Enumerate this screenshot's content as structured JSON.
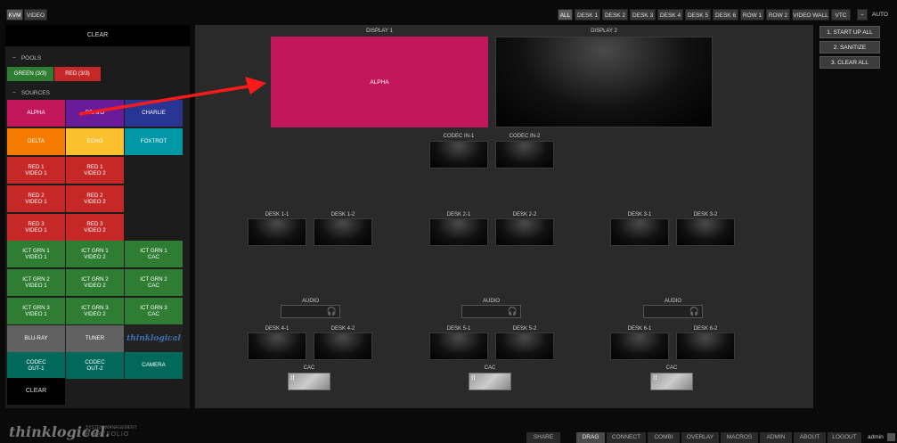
{
  "topbar": {
    "left": [
      "KVM",
      "VIDEO"
    ],
    "right": [
      "ALL",
      "DESK 1",
      "DESK 2",
      "DESK 3",
      "DESK 4",
      "DESK 5",
      "DESK 6",
      "ROW 1",
      "ROW 2",
      "VIDEO WALL",
      "VTC"
    ],
    "collapse": "−",
    "auto": "AUTO"
  },
  "left": {
    "clear_top": "CLEAR",
    "pools_header": "POOLS",
    "pools": [
      {
        "label": "GREEN (3/3)",
        "color": "#2e7d32"
      },
      {
        "label": "RED (3/3)",
        "color": "#c62828"
      }
    ],
    "sources_header": "SOURCES",
    "sources": [
      {
        "label": "ALPHA",
        "color": "#c2185b"
      },
      {
        "label": "BRAVO",
        "color": "#6a1b9a"
      },
      {
        "label": "CHARLIE",
        "color": "#283593"
      },
      {
        "label": "DELTA",
        "color": "#f57c00"
      },
      {
        "label": "ECHO",
        "color": "#fbc02d"
      },
      {
        "label": "FOXTROT",
        "color": "#0097a7"
      },
      {
        "label": "RED 1\nVIDEO 1",
        "color": "#c62828"
      },
      {
        "label": "RED 1\nVIDEO 2",
        "color": "#c62828"
      },
      {
        "label": "RED 2\nVIDEO 1",
        "color": "#c62828"
      },
      {
        "label": "RED 2\nVIDEO 2",
        "color": "#c62828"
      },
      {
        "label": "RED 3\nVIDEO 1",
        "color": "#c62828"
      },
      {
        "label": "RED 3\nVIDEO 2",
        "color": "#c62828"
      },
      {
        "label": "ICT GRN 1\nVIDEO 1",
        "color": "#2e7d32"
      },
      {
        "label": "ICT GRN 1\nVIDEO 2",
        "color": "#2e7d32"
      },
      {
        "label": "ICT GRN 1\nCAC",
        "color": "#2e7d32"
      },
      {
        "label": "ICT GRN 2\nVIDEO 1",
        "color": "#2e7d32"
      },
      {
        "label": "ICT GRN 2\nVIDEO 2",
        "color": "#2e7d32"
      },
      {
        "label": "ICT GRN 2\nCAC",
        "color": "#2e7d32"
      },
      {
        "label": "ICT GRN 3\nVIDEO 1",
        "color": "#2e7d32"
      },
      {
        "label": "ICT GRN 3\nVIDEO 2",
        "color": "#2e7d32"
      },
      {
        "label": "ICT GRN 3\nCAC",
        "color": "#2e7d32"
      },
      {
        "label": "BLU-RAY",
        "color": "#616161"
      },
      {
        "label": "TUNER",
        "color": "#616161"
      },
      {
        "label": "thinklogical",
        "color": "#222"
      },
      {
        "label": "CODEC\nOUT-1",
        "color": "#00695c"
      },
      {
        "label": "CODEC\nOUT-2",
        "color": "#00695c"
      },
      {
        "label": "CAMERA",
        "color": "#00695c"
      }
    ],
    "clear_bottom": "CLEAR"
  },
  "main": {
    "display1": {
      "label": "DISPLAY 1",
      "content": "ALPHA",
      "color": "#c2185b"
    },
    "display2": {
      "label": "DISPLAY 2"
    },
    "codec_in": [
      "CODEC IN-1",
      "CODEC IN-2"
    ],
    "desks_row1": [
      "DESK 1-1",
      "DESK 1-2",
      "DESK 2-1",
      "DESK 2-2",
      "DESK 3-1",
      "DESK 3-2"
    ],
    "desks_row2": [
      "DESK 4-1",
      "DESK 4-2",
      "DESK 5-1",
      "DESK 5-2",
      "DESK 6-1",
      "DESK 6-2"
    ],
    "audio": "AUDIO",
    "cac": "CAC"
  },
  "right": {
    "buttons": [
      "1. START UP ALL",
      "2. SANITIZE",
      "3. CLEAR ALL"
    ]
  },
  "bottom": {
    "logo": "thinklogical.",
    "logo_sub1": "SYSTEM MANAGEMENT",
    "logo_sub2": "PORTFOLIO",
    "share": "SHARE",
    "nav": [
      "DRAG",
      "CONNECT",
      "COMBI",
      "OVERLAY",
      "MACROS",
      "ADMIN",
      "ABOUT",
      "LOGOUT"
    ],
    "user": "admin"
  }
}
